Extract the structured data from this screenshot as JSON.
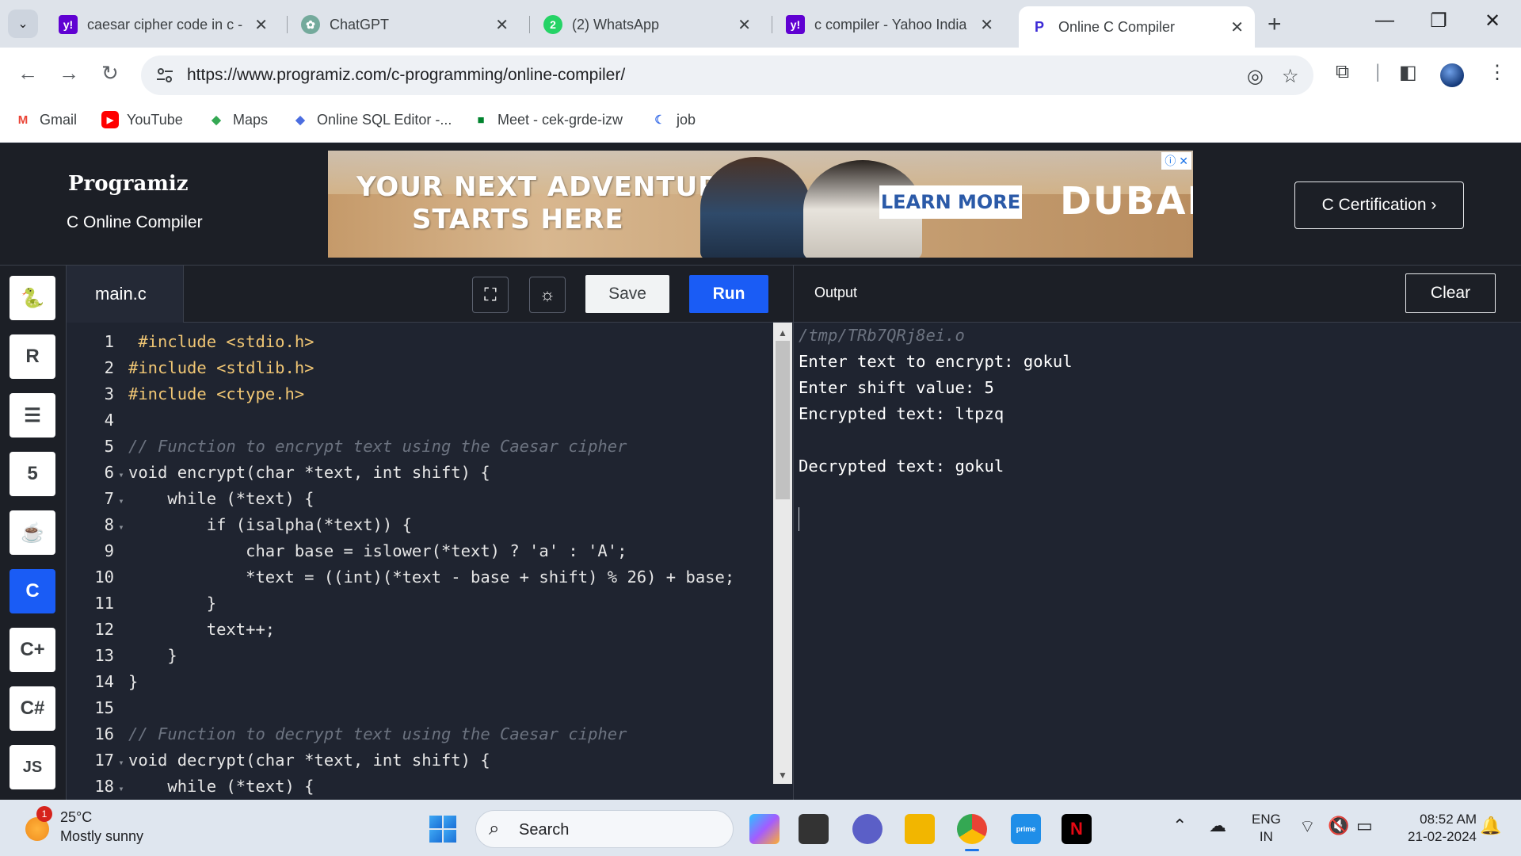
{
  "browser": {
    "tabs": [
      {
        "title": "caesar cipher code in c -",
        "favicon": "yahoo-icon",
        "color": "#6001d2"
      },
      {
        "title": "ChatGPT",
        "favicon": "chatgpt-icon",
        "color": "#74aa9c"
      },
      {
        "title": "(2) WhatsApp",
        "favicon": "whatsapp-icon",
        "color": "#25d366"
      },
      {
        "title": "c compiler - Yahoo India",
        "favicon": "yahoo-icon",
        "color": "#6001d2"
      },
      {
        "title": "Online C Compiler",
        "favicon": "programiz-icon",
        "color": "#3c2ad6"
      }
    ],
    "url": "https://www.programiz.com/c-programming/online-compiler/",
    "bookmarks": [
      {
        "label": "Gmail",
        "icon": "gmail-icon"
      },
      {
        "label": "YouTube",
        "icon": "youtube-icon"
      },
      {
        "label": "Maps",
        "icon": "maps-icon"
      },
      {
        "label": "Online SQL Editor -...",
        "icon": "sql-editor-icon"
      },
      {
        "label": "Meet - cek-grde-izw",
        "icon": "meet-icon"
      },
      {
        "label": "job",
        "icon": "job-icon"
      }
    ]
  },
  "site": {
    "logo": "Programiz",
    "subtitle": "C Online Compiler",
    "cert_button": "C Certification ›",
    "ad": {
      "headline_line1": "YOUR NEXT ADVENTURE",
      "headline_line2": "STARTS HERE",
      "cta": "LEARN MORE",
      "brand": "DUBAI"
    }
  },
  "editor": {
    "filename": "main.c",
    "save_label": "Save",
    "run_label": "Run",
    "output_label": "Output",
    "clear_label": "Clear",
    "lines": [
      {
        "n": "1",
        "fold": false
      },
      {
        "n": "2",
        "fold": false
      },
      {
        "n": "3",
        "fold": false
      },
      {
        "n": "4",
        "fold": false
      },
      {
        "n": "5",
        "fold": false
      },
      {
        "n": "6",
        "fold": true
      },
      {
        "n": "7",
        "fold": true
      },
      {
        "n": "8",
        "fold": true
      },
      {
        "n": "9",
        "fold": false
      },
      {
        "n": "10",
        "fold": false
      },
      {
        "n": "11",
        "fold": false
      },
      {
        "n": "12",
        "fold": false
      },
      {
        "n": "13",
        "fold": false
      },
      {
        "n": "14",
        "fold": false
      },
      {
        "n": "15",
        "fold": false
      },
      {
        "n": "16",
        "fold": false
      },
      {
        "n": "17",
        "fold": true
      },
      {
        "n": "18",
        "fold": true
      }
    ],
    "code": [
      " #include <stdio.h>",
      "#include <stdlib.h>",
      "#include <ctype.h>",
      "",
      "// Function to encrypt text using the Caesar cipher",
      "void encrypt(char *text, int shift) {",
      "    while (*text) {",
      "        if (isalpha(*text)) {",
      "            char base = islower(*text) ? 'a' : 'A';",
      "            *text = ((int)(*text - base + shift) % 26) + base;",
      "        }",
      "        text++;",
      "    }",
      "}",
      "",
      "// Function to decrypt text using the Caesar cipher",
      "void decrypt(char *text, int shift) {",
      "    while (*text) {"
    ]
  },
  "output": {
    "path": "/tmp/TRb7QRj8ei.o",
    "lines": [
      "Enter text to encrypt: gokul",
      "Enter shift value: 5",
      "Encrypted text: ltpzq",
      "",
      "Decrypted text: gokul"
    ]
  },
  "rail": [
    {
      "name": "python-icon",
      "active": false
    },
    {
      "name": "r-lang-icon",
      "active": false
    },
    {
      "name": "sql-database-icon",
      "active": false
    },
    {
      "name": "html5-icon",
      "active": false
    },
    {
      "name": "java-icon",
      "active": false
    },
    {
      "name": "c-lang-icon",
      "active": true
    },
    {
      "name": "cpp-icon",
      "active": false
    },
    {
      "name": "csharp-icon",
      "active": false
    },
    {
      "name": "js-icon",
      "active": false,
      "label": "JS"
    }
  ],
  "taskbar": {
    "weather_temp": "25°C",
    "weather_desc": "Mostly sunny",
    "weather_badge": "1",
    "search_placeholder": "Search",
    "lang_line1": "ENG",
    "lang_line2": "IN",
    "time": "08:52 AM",
    "date": "21-02-2024"
  },
  "colors": {
    "accent": "#1a5cf5",
    "editor_bg": "#1f2430"
  }
}
